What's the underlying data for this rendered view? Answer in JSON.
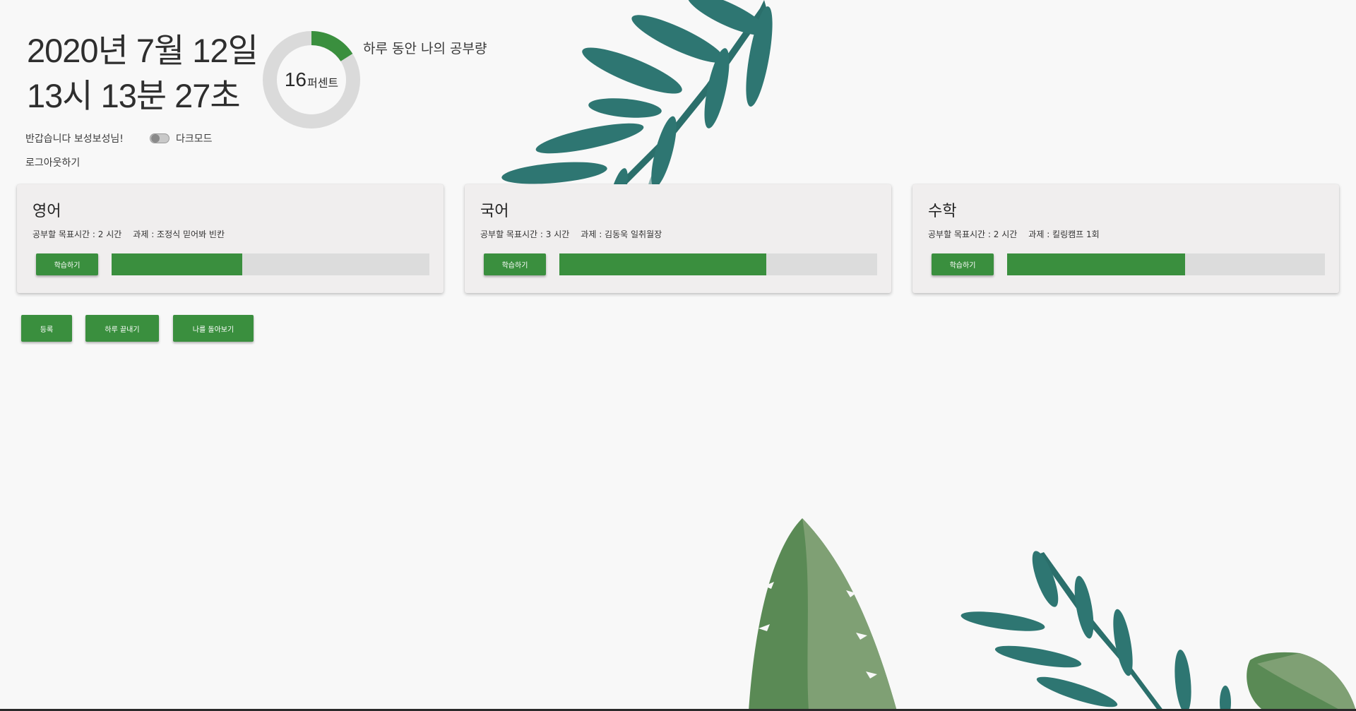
{
  "header": {
    "date_line": "2020년 7월 12일",
    "time_line": "13시 13분 27초"
  },
  "daily_progress": {
    "percent": 16,
    "unit": "퍼센트",
    "caption": "하루 동안 나의 공부량",
    "fill_color": "#3a8f3e",
    "track_color": "#dadada"
  },
  "user": {
    "greeting": "반갑습니다 보성보성님!",
    "dark_mode_label": "다크모드",
    "dark_mode_on": false,
    "logout_label": "로그아웃하기"
  },
  "subjects": [
    {
      "name": "영어",
      "goal": "공부할 목표시간 : 2 시간",
      "task": "과제 : 조정식 믿어봐 빈칸",
      "button": "학습하기",
      "progress": 0.41
    },
    {
      "name": "국어",
      "goal": "공부할 목표시간 : 3 시간",
      "task": "과제 : 김동욱 일취월장",
      "button": "학습하기",
      "progress": 0.65
    },
    {
      "name": "수학",
      "goal": "공부할 목표시간 : 2 시간",
      "task": "과제 : 킬링캠프 1회",
      "button": "학습하기",
      "progress": 0.56
    }
  ],
  "actions": {
    "register": "등록",
    "end_day": "하루 끝내기",
    "review": "나를 돌아보기"
  },
  "colors": {
    "accent": "#3a8f3e",
    "card_bg": "#f0eeee",
    "page_bg": "#f8f8f8",
    "leaf_teal": "#2e7672",
    "leaf_green": "#5a8a55"
  }
}
